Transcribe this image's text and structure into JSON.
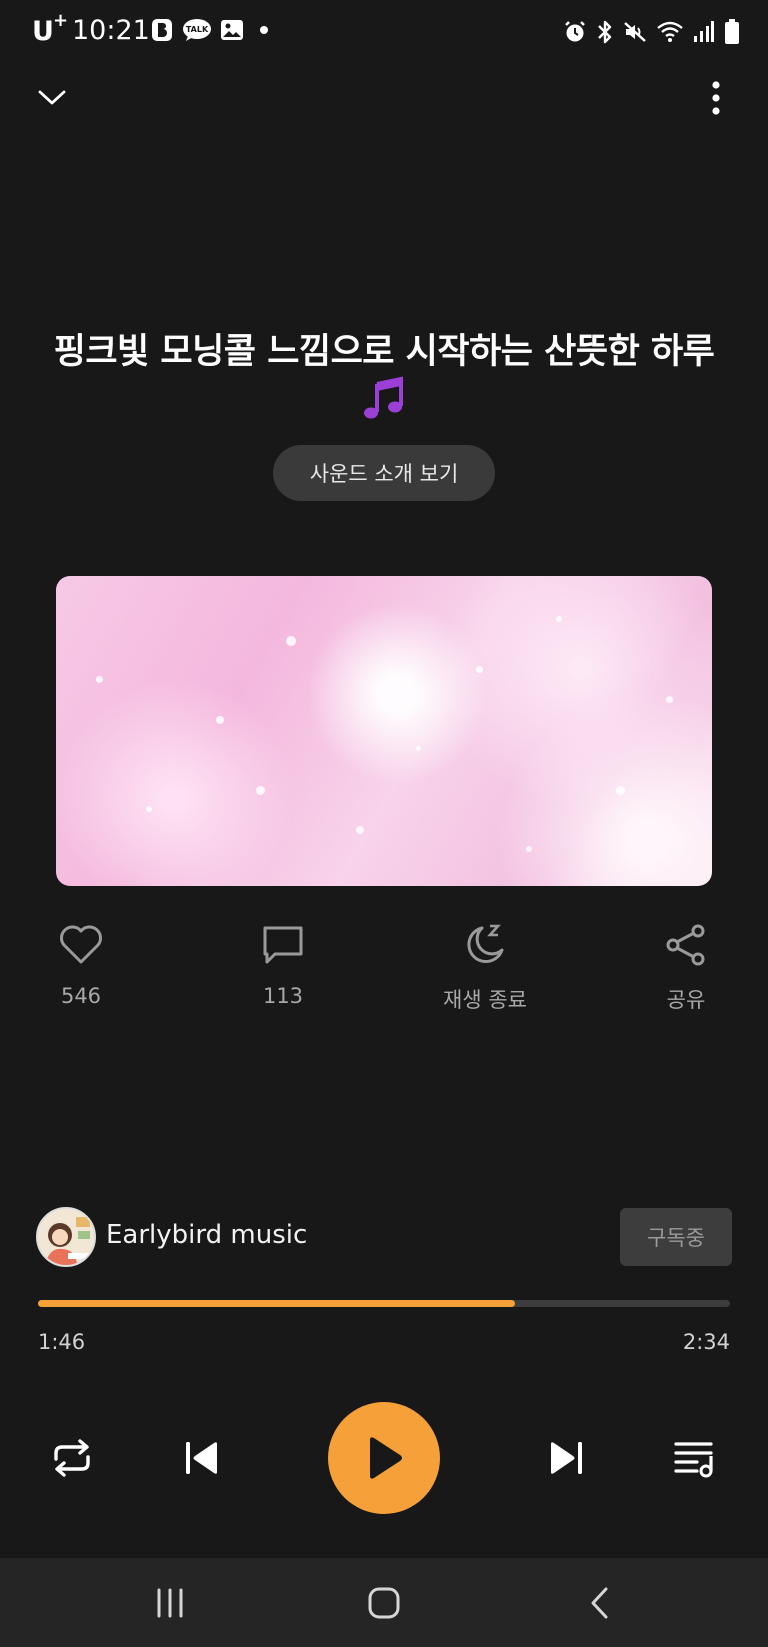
{
  "status_bar": {
    "carrier": "U",
    "carrier_plus": "+",
    "time": "10:21",
    "notification_icons": [
      "b-app-icon",
      "kakaotalk-icon",
      "gallery-icon",
      "dot-icon"
    ],
    "system_icons": [
      "alarm-icon",
      "bluetooth-icon",
      "mute-icon",
      "wifi-icon",
      "signal-icon",
      "battery-icon"
    ],
    "talk_badge": "TALK"
  },
  "header": {
    "collapse_icon": "chevron-down-icon",
    "more_icon": "more-vertical-icon"
  },
  "track": {
    "title": "핑크빛 모닝콜 느낌으로 시작하는 산뜻한 하루",
    "title_emoji_icon": "music-note-icon",
    "intro_button": "사운드 소개 보기"
  },
  "actions": {
    "like_count": "546",
    "comment_count": "113",
    "sleep_timer_label": "재생 종료",
    "share_label": "공유"
  },
  "channel": {
    "name": "Earlybird music",
    "subscribe_label": "구독중"
  },
  "playback": {
    "elapsed": "1:46",
    "total": "2:34",
    "progress_fraction": 0.69
  },
  "colors": {
    "background": "#181818",
    "accent": "#f5a038",
    "nav_bar": "#252525"
  }
}
